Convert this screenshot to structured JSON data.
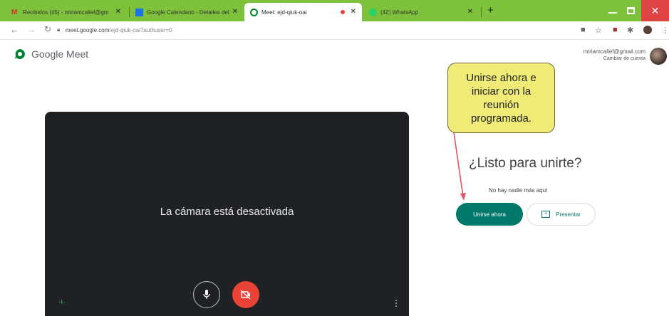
{
  "browser": {
    "tabs": [
      {
        "label": "Recibidos (45) - miriamcallef@gm"
      },
      {
        "label": "Google Calendario - Detalles del"
      },
      {
        "label": "Meet: ejd-qiuk-oai"
      },
      {
        "label": "(42) WhatsApp"
      }
    ],
    "new_tab": "+",
    "url_host": "meet.google.com",
    "url_path": "/ejd-qiuk-oai?authuser=0"
  },
  "meet": {
    "logo_text": "Google Meet",
    "account_email": "miriamcallef@gmail.com",
    "switch_account": "Cambiar de cuenta",
    "camera_off": "La cámara está desactivada",
    "ready_title": "¿Listo para unirte?",
    "nobody_here": "No hay nadie más aquí",
    "join_button": "Unirse ahora",
    "present_button": "Presentar"
  },
  "annotation": {
    "callout_text": "Unirse ahora e iniciar con la reunión programada."
  },
  "colors": {
    "tab_bar": "#7ec13a",
    "join": "#00796b",
    "cam_off_button": "#ea4335",
    "callout": "#f0ea76",
    "arrow": "#e0536a"
  }
}
